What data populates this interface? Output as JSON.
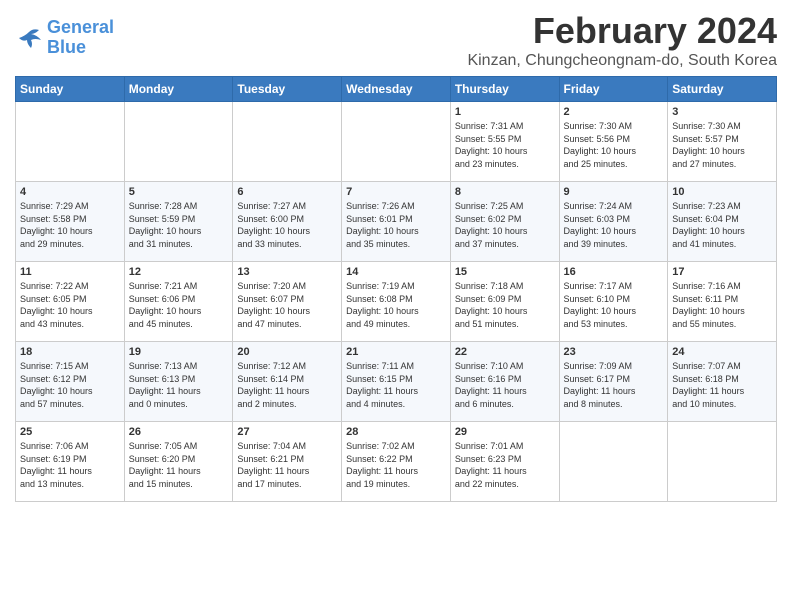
{
  "logo": {
    "text_general": "General",
    "text_blue": "Blue"
  },
  "title": "February 2024",
  "subtitle": "Kinzan, Chungcheongnam-do, South Korea",
  "days_of_week": [
    "Sunday",
    "Monday",
    "Tuesday",
    "Wednesday",
    "Thursday",
    "Friday",
    "Saturday"
  ],
  "weeks": [
    [
      {
        "day": "",
        "info": ""
      },
      {
        "day": "",
        "info": ""
      },
      {
        "day": "",
        "info": ""
      },
      {
        "day": "",
        "info": ""
      },
      {
        "day": "1",
        "info": "Sunrise: 7:31 AM\nSunset: 5:55 PM\nDaylight: 10 hours\nand 23 minutes."
      },
      {
        "day": "2",
        "info": "Sunrise: 7:30 AM\nSunset: 5:56 PM\nDaylight: 10 hours\nand 25 minutes."
      },
      {
        "day": "3",
        "info": "Sunrise: 7:30 AM\nSunset: 5:57 PM\nDaylight: 10 hours\nand 27 minutes."
      }
    ],
    [
      {
        "day": "4",
        "info": "Sunrise: 7:29 AM\nSunset: 5:58 PM\nDaylight: 10 hours\nand 29 minutes."
      },
      {
        "day": "5",
        "info": "Sunrise: 7:28 AM\nSunset: 5:59 PM\nDaylight: 10 hours\nand 31 minutes."
      },
      {
        "day": "6",
        "info": "Sunrise: 7:27 AM\nSunset: 6:00 PM\nDaylight: 10 hours\nand 33 minutes."
      },
      {
        "day": "7",
        "info": "Sunrise: 7:26 AM\nSunset: 6:01 PM\nDaylight: 10 hours\nand 35 minutes."
      },
      {
        "day": "8",
        "info": "Sunrise: 7:25 AM\nSunset: 6:02 PM\nDaylight: 10 hours\nand 37 minutes."
      },
      {
        "day": "9",
        "info": "Sunrise: 7:24 AM\nSunset: 6:03 PM\nDaylight: 10 hours\nand 39 minutes."
      },
      {
        "day": "10",
        "info": "Sunrise: 7:23 AM\nSunset: 6:04 PM\nDaylight: 10 hours\nand 41 minutes."
      }
    ],
    [
      {
        "day": "11",
        "info": "Sunrise: 7:22 AM\nSunset: 6:05 PM\nDaylight: 10 hours\nand 43 minutes."
      },
      {
        "day": "12",
        "info": "Sunrise: 7:21 AM\nSunset: 6:06 PM\nDaylight: 10 hours\nand 45 minutes."
      },
      {
        "day": "13",
        "info": "Sunrise: 7:20 AM\nSunset: 6:07 PM\nDaylight: 10 hours\nand 47 minutes."
      },
      {
        "day": "14",
        "info": "Sunrise: 7:19 AM\nSunset: 6:08 PM\nDaylight: 10 hours\nand 49 minutes."
      },
      {
        "day": "15",
        "info": "Sunrise: 7:18 AM\nSunset: 6:09 PM\nDaylight: 10 hours\nand 51 minutes."
      },
      {
        "day": "16",
        "info": "Sunrise: 7:17 AM\nSunset: 6:10 PM\nDaylight: 10 hours\nand 53 minutes."
      },
      {
        "day": "17",
        "info": "Sunrise: 7:16 AM\nSunset: 6:11 PM\nDaylight: 10 hours\nand 55 minutes."
      }
    ],
    [
      {
        "day": "18",
        "info": "Sunrise: 7:15 AM\nSunset: 6:12 PM\nDaylight: 10 hours\nand 57 minutes."
      },
      {
        "day": "19",
        "info": "Sunrise: 7:13 AM\nSunset: 6:13 PM\nDaylight: 11 hours\nand 0 minutes."
      },
      {
        "day": "20",
        "info": "Sunrise: 7:12 AM\nSunset: 6:14 PM\nDaylight: 11 hours\nand 2 minutes."
      },
      {
        "day": "21",
        "info": "Sunrise: 7:11 AM\nSunset: 6:15 PM\nDaylight: 11 hours\nand 4 minutes."
      },
      {
        "day": "22",
        "info": "Sunrise: 7:10 AM\nSunset: 6:16 PM\nDaylight: 11 hours\nand 6 minutes."
      },
      {
        "day": "23",
        "info": "Sunrise: 7:09 AM\nSunset: 6:17 PM\nDaylight: 11 hours\nand 8 minutes."
      },
      {
        "day": "24",
        "info": "Sunrise: 7:07 AM\nSunset: 6:18 PM\nDaylight: 11 hours\nand 10 minutes."
      }
    ],
    [
      {
        "day": "25",
        "info": "Sunrise: 7:06 AM\nSunset: 6:19 PM\nDaylight: 11 hours\nand 13 minutes."
      },
      {
        "day": "26",
        "info": "Sunrise: 7:05 AM\nSunset: 6:20 PM\nDaylight: 11 hours\nand 15 minutes."
      },
      {
        "day": "27",
        "info": "Sunrise: 7:04 AM\nSunset: 6:21 PM\nDaylight: 11 hours\nand 17 minutes."
      },
      {
        "day": "28",
        "info": "Sunrise: 7:02 AM\nSunset: 6:22 PM\nDaylight: 11 hours\nand 19 minutes."
      },
      {
        "day": "29",
        "info": "Sunrise: 7:01 AM\nSunset: 6:23 PM\nDaylight: 11 hours\nand 22 minutes."
      },
      {
        "day": "",
        "info": ""
      },
      {
        "day": "",
        "info": ""
      }
    ]
  ]
}
